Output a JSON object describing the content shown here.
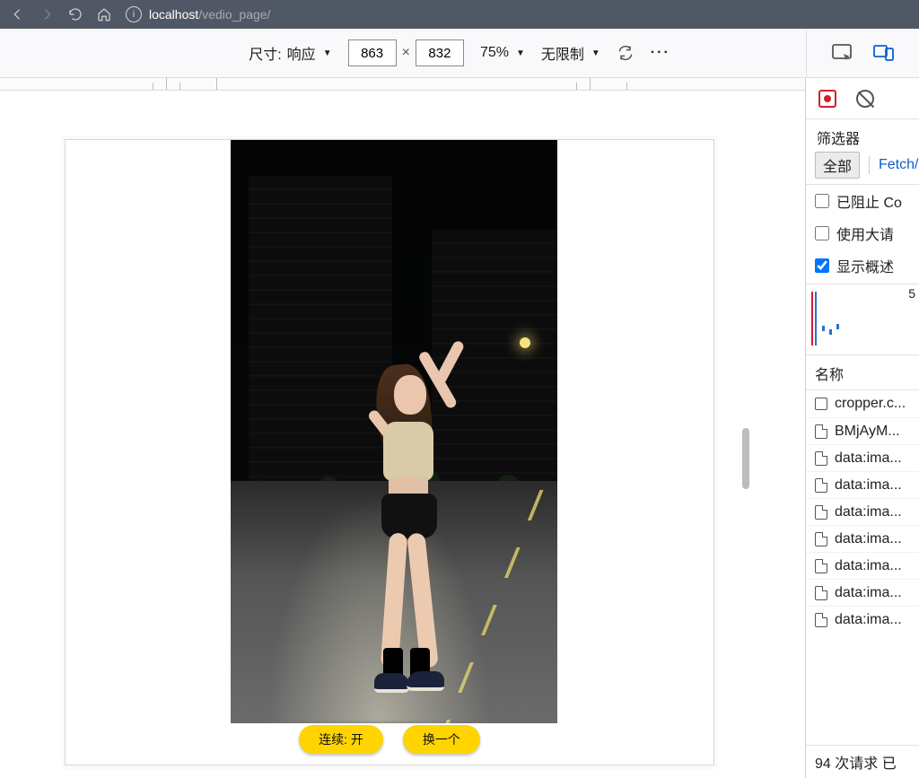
{
  "browser": {
    "url_host": "localhost",
    "url_path": "/vedio_page/"
  },
  "rdm": {
    "size_label": "尺寸:",
    "device": "响应",
    "width": "863",
    "height": "832",
    "zoom": "75%",
    "throttling": "无限制",
    "more": "···"
  },
  "page": {
    "buttons": {
      "continuous": "连续: 开",
      "next": "换一个"
    }
  },
  "devtools": {
    "filter_label": "筛选器",
    "type_all": "全部",
    "type_fetch": "Fetch/",
    "check_blocked": "已阻止 Co",
    "check_large": "使用大请",
    "check_overview": "显示概述",
    "timeline_tick": "5",
    "col_name": "名称",
    "status": "94 次请求  已",
    "rows": [
      {
        "icon": "checkbox",
        "label": "cropper.c..."
      },
      {
        "icon": "file",
        "label": "BMjAyM..."
      },
      {
        "icon": "file",
        "label": "data:ima..."
      },
      {
        "icon": "file",
        "label": "data:ima..."
      },
      {
        "icon": "file",
        "label": "data:ima..."
      },
      {
        "icon": "file",
        "label": "data:ima..."
      },
      {
        "icon": "file",
        "label": "data:ima..."
      },
      {
        "icon": "file",
        "label": "data:ima..."
      },
      {
        "icon": "file",
        "label": "data:ima..."
      }
    ]
  }
}
